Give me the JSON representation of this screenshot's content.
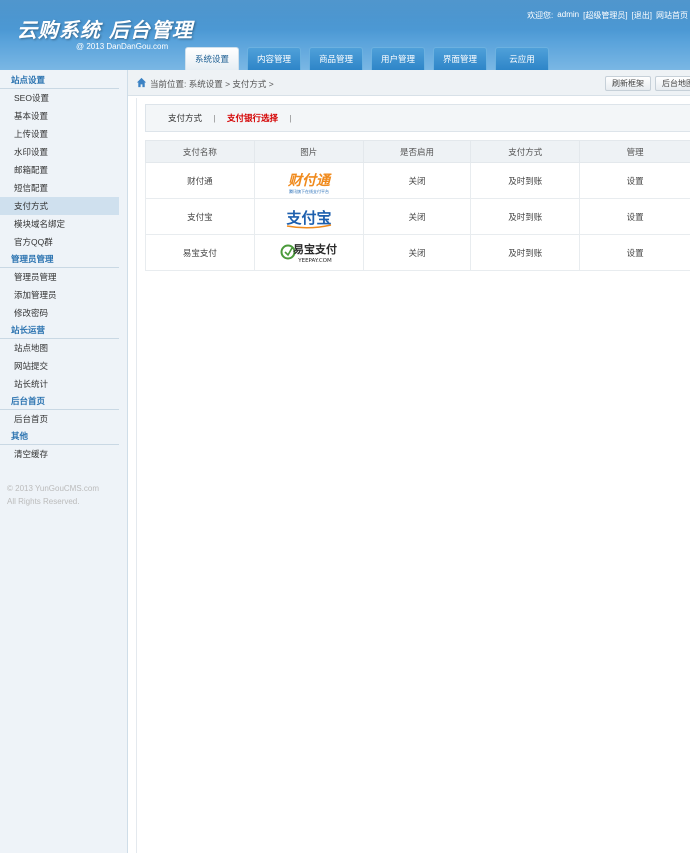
{
  "header": {
    "brand": "云购系统 后台管理",
    "brand_sub": "@ 2013  DanDanGou.com",
    "welcome": "欢迎您:",
    "user": "admin",
    "role": "[超级管理员]",
    "logout": "[退出]",
    "site_home": "网站首页",
    "tabs": [
      {
        "label": "系统设置",
        "active": true
      },
      {
        "label": "内容管理"
      },
      {
        "label": "商品管理"
      },
      {
        "label": "用户管理"
      },
      {
        "label": "界面管理"
      },
      {
        "label": "云应用"
      }
    ]
  },
  "sidebar": {
    "groups": [
      {
        "title": "站点设置",
        "items": [
          "SEO设置",
          "基本设置",
          "上传设置",
          "水印设置",
          "邮箱配置",
          "短信配置",
          "支付方式",
          "模块域名绑定",
          "官方QQ群"
        ]
      },
      {
        "title": "管理员管理",
        "items": [
          "管理员管理",
          "添加管理员",
          "修改密码"
        ]
      },
      {
        "title": "站长运营",
        "items": [
          "站点地图",
          "网站提交",
          "站长统计"
        ]
      },
      {
        "title": "后台首页",
        "items": [
          "后台首页"
        ]
      },
      {
        "title": "其他",
        "items": [
          "清空缓存"
        ]
      }
    ],
    "active_item": "支付方式",
    "copyright_line1": "© 2013 YunGouCMS.com",
    "copyright_line2": "All Rights Reserved."
  },
  "main": {
    "breadcrumb": "当前位置: 系统设置 > 支付方式 >",
    "refresh_button": "刷新框架",
    "backend_map_button": "后台地图",
    "subnav": {
      "item1": "支付方式",
      "separator": "|",
      "item2": "支付银行选择",
      "trailing_separator": "|"
    },
    "table": {
      "headers": [
        "支付名称",
        "图片",
        "是否启用",
        "支付方式",
        "管理"
      ],
      "rows": [
        {
          "name": "财付通",
          "logo": "tenpay-logo",
          "logo_text": "财付通",
          "logo_sub": "腾讯旗下在线支付平台",
          "enabled": "关闭",
          "method": "及时到账",
          "action": "设置"
        },
        {
          "name": "支付宝",
          "logo": "alipay-logo",
          "logo_text": "支付宝",
          "enabled": "关闭",
          "method": "及时到账",
          "action": "设置"
        },
        {
          "name": "易宝支付",
          "logo": "yeepay-logo",
          "logo_text": "易宝支付",
          "logo_sub": "YEEPAY.COM",
          "enabled": "关闭",
          "method": "及时到账",
          "action": "设置"
        }
      ]
    }
  },
  "colors": {
    "header_blue": "#2a7fc2",
    "active_tab_text": "#1a5d92",
    "status_red": "#d62a2a",
    "subnav_active": "#d40000",
    "sidebar_bg": "#eef3f8"
  }
}
